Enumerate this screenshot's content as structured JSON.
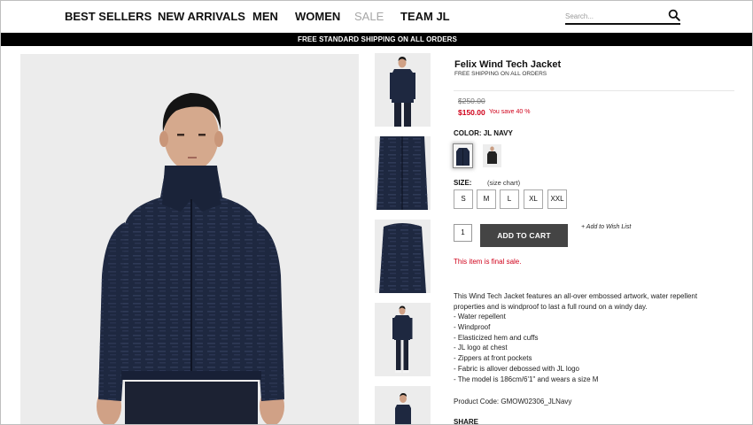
{
  "nav": {
    "items": [
      {
        "label": "BEST SELLERS"
      },
      {
        "label": "NEW ARRIVALS"
      },
      {
        "label": "MEN"
      },
      {
        "label": "WOMEN"
      },
      {
        "label": "SALE"
      },
      {
        "label": "TEAM JL"
      }
    ],
    "search_placeholder": "Search..."
  },
  "banner": {
    "text": "FREE STANDARD SHIPPING ON ALL ORDERS"
  },
  "product": {
    "title": "Felix Wind Tech Jacket",
    "shipping": "FREE SHIPPING ON ALL ORDERS",
    "price_old": "$250.00",
    "price_new": "$150.00",
    "save_text": "You save 40 %",
    "color_label": "COLOR: JL NAVY",
    "size_label": "SIZE:",
    "size_chart_link": "(size chart)",
    "sizes": [
      "S",
      "M",
      "L",
      "XL",
      "XXL"
    ],
    "quantity": "1",
    "add_to_cart": "ADD TO CART",
    "wishlist": "+ Add to Wish List",
    "final_sale": "This item is final sale.",
    "description": "This Wind Tech Jacket features an all-over embossed artwork, water repellent properties and is windproof to last a full round on a windy day.",
    "features": [
      "- Water repellent",
      "- Windproof",
      "- Elasticized hem and cuffs",
      "- JL logo at chest",
      "- Zippers at front pockets",
      "- Fabric is allover debossed with JL logo",
      "- The model is 186cm/6'1\" and wears a size M"
    ],
    "product_code": "Product Code:  GMOW02306_JLNavy",
    "share": "SHARE"
  },
  "colors": {
    "jacket_navy": "#1e2840",
    "banner": "#000000",
    "cart_button": "#444444",
    "sale_red": "#d0021b",
    "image_bg": "#ececec"
  }
}
